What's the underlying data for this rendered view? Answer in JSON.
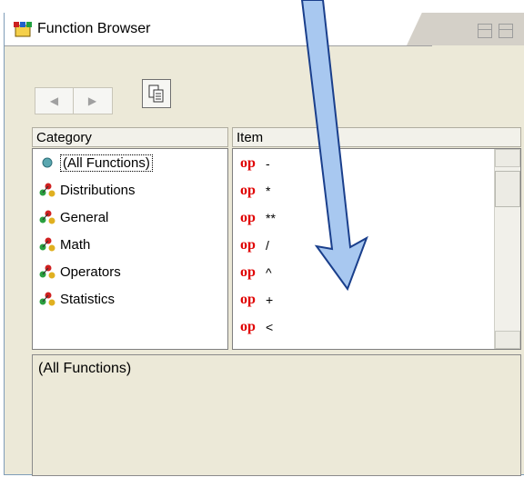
{
  "window": {
    "title": "Function Browser"
  },
  "toolbar": {
    "back_icon": "arrow-left-icon",
    "forward_icon": "arrow-right-icon",
    "copy_icon": "copy-icon"
  },
  "category": {
    "header": "Category",
    "items": [
      {
        "label": "(All Functions)",
        "icon": "circle-icon",
        "selected": true
      },
      {
        "label": "Distributions",
        "icon": "category-icon"
      },
      {
        "label": "General",
        "icon": "category-icon"
      },
      {
        "label": "Math",
        "icon": "category-icon"
      },
      {
        "label": "Operators",
        "icon": "category-icon"
      },
      {
        "label": "Statistics",
        "icon": "category-icon"
      }
    ]
  },
  "items": {
    "header": "Item",
    "rows": [
      {
        "tag": "op",
        "symbol": "-"
      },
      {
        "tag": "op",
        "symbol": "*"
      },
      {
        "tag": "op",
        "symbol": "**"
      },
      {
        "tag": "op",
        "symbol": "/"
      },
      {
        "tag": "op",
        "symbol": "^"
      },
      {
        "tag": "op",
        "symbol": "+"
      },
      {
        "tag": "op",
        "symbol": "<"
      }
    ]
  },
  "description": {
    "text": "(All Functions)"
  },
  "colors": {
    "op_tag": "#e00000",
    "arrow_fill": "#a8c8f0",
    "panel_bg": "#ece9d8"
  }
}
